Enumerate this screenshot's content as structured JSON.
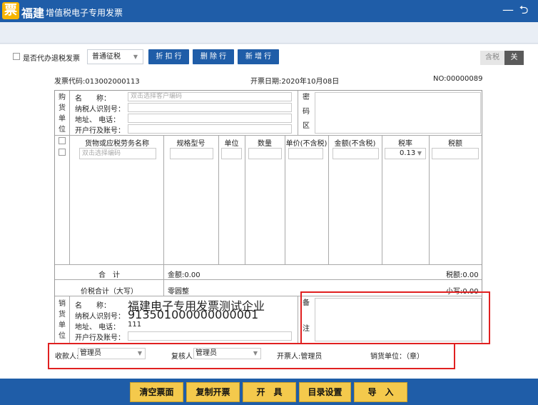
{
  "app": {
    "logo_char": "票",
    "logo_text": "福建",
    "window_title": "增值税电子专用发票",
    "minimize_glyph": "—",
    "back_glyph": "⮌"
  },
  "toolbar": {
    "refund_checkbox_label": "是否代办退税发票",
    "tax_mode_value": "普通征税",
    "discount_button": "折 扣 行",
    "delete_button": "删 除 行",
    "add_button": "新 增 行",
    "tax_toggle_off": "含税",
    "tax_toggle_on": "关"
  },
  "meta": {
    "invoice_code": "发票代码:013002000113",
    "issue_date": "开票日期:2020年10月08日",
    "invoice_no": "NO:00000089"
  },
  "buyer": {
    "side_label": "购\n货\n单\n位",
    "name_label": "名　　称：",
    "name_placeholder": "双击选择客户编码",
    "taxid_label": "纳税人识别号：",
    "address_label": "地址、  电话：",
    "bank_label": "开户行及账号：",
    "cipher_label": "密\n码\n区"
  },
  "goods": {
    "headers": [
      "货物或应税劳务名称",
      "规格型号",
      "单位",
      "数量",
      "单价(不含税)",
      "金额(不含税)",
      "税率",
      "税额"
    ],
    "name_placeholder": "双击选择编码",
    "tax_rate": "0.13"
  },
  "totals": {
    "sum_label": "合　计",
    "amount": "金额:0.00",
    "tax": "税额:0.00",
    "total_words_label": "价税合计（大写）",
    "total_words": "零圆整",
    "total_lower": "小写:0.00"
  },
  "seller": {
    "side_label": "销\n货\n单\n位",
    "name_label": "名　　称：",
    "name_value": "福建电子专用发票测试企业",
    "taxid_label": "纳税人识别号：",
    "taxid_value": "913501000000000001",
    "address_label": "地址、  电话：",
    "address_value": "111",
    "bank_label": "开户行及账号：",
    "remarks_label": "备\n\n\n注"
  },
  "signatures": {
    "payee_label": "收款人:",
    "payee_value": "管理员",
    "reviewer_label": "复核人:",
    "reviewer_value": "管理员",
    "drawer": "开票人:管理员",
    "seller_unit": "销货单位：（章）"
  },
  "actions": {
    "clear": "清空票面",
    "copy": "复制开票",
    "issue": "开　具",
    "catalog": "目录设置",
    "import": "导　入"
  },
  "colors": {
    "titlebar": "#1f5da8",
    "action_button": "#f4c94c",
    "highlight": "#e02020"
  }
}
